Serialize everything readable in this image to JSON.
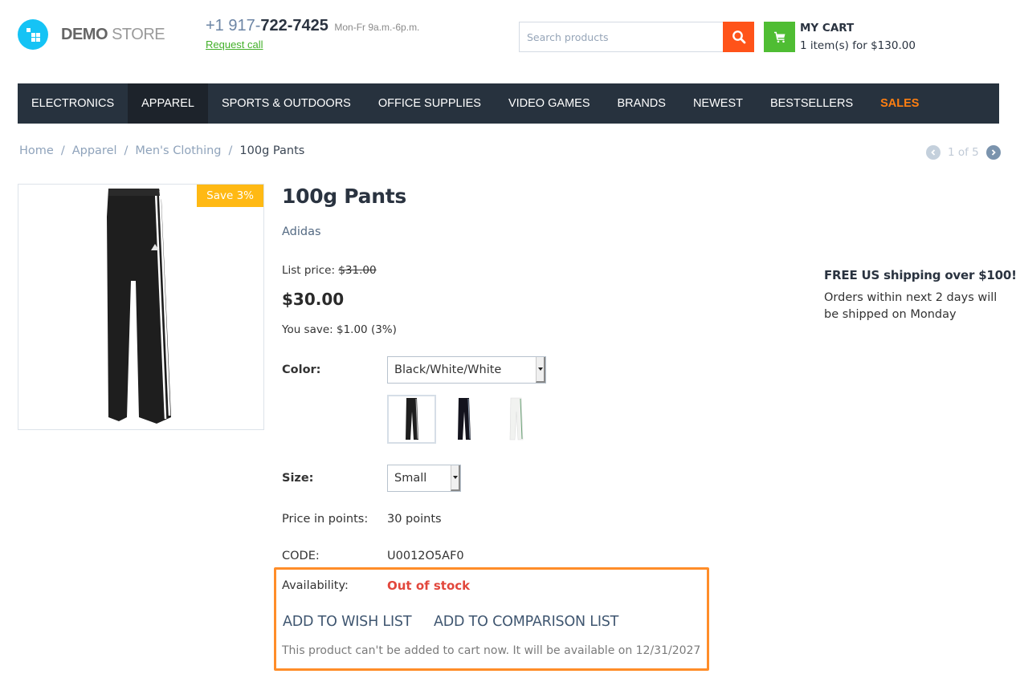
{
  "header": {
    "logo": {
      "bold": "DEMO",
      "light": "STORE"
    },
    "phone": {
      "prefix": "+1 917-",
      "number": "722-7425",
      "hours": "Mon-Fr 9a.m.-6p.m.",
      "request_call": "Request call"
    },
    "search": {
      "placeholder": "Search products",
      "value": ""
    },
    "cart": {
      "title": "MY CART",
      "summary": "1 item(s) for $130.00"
    }
  },
  "nav": {
    "items": [
      {
        "label": "ELECTRONICS"
      },
      {
        "label": "APPAREL",
        "active": true
      },
      {
        "label": "SPORTS & OUTDOORS"
      },
      {
        "label": "OFFICE SUPPLIES"
      },
      {
        "label": "VIDEO GAMES"
      },
      {
        "label": "BRANDS"
      },
      {
        "label": "NEWEST"
      },
      {
        "label": "BESTSELLERS"
      },
      {
        "label": "SALES",
        "highlight": true
      }
    ]
  },
  "breadcrumb": {
    "items": [
      "Home",
      "Apparel",
      "Men's Clothing"
    ],
    "separator": "/",
    "current": "100g Pants"
  },
  "pager": {
    "text": "1 of 5"
  },
  "product": {
    "badge": "Save 3%",
    "title": "100g Pants",
    "brand": "Adidas",
    "list_price_label": "List price:",
    "list_price": "$31.00",
    "price": "$30.00",
    "you_save": "You save: $1.00 (3%)",
    "color_label": "Color:",
    "color_value": "Black/White/White",
    "color_swatches": [
      "Black/White/White",
      "Black/Navy",
      "White/Green"
    ],
    "size_label": "Size:",
    "size_value": "Small",
    "points_label": "Price in points:",
    "points_value": "30 points",
    "code_label": "CODE:",
    "code_value": "U0012O5AF0",
    "availability_label": "Availability:",
    "availability_value": "Out of stock",
    "wish_list": "ADD TO WISH LIST",
    "comparison_list": "ADD TO COMPARISON LIST",
    "availability_note": "This product can't be added to cart now. It will be available on 12/31/2027"
  },
  "shipping": {
    "title": "FREE US shipping over $100!",
    "text": "Orders within next 2 days will be shipped on Monday"
  },
  "colors": {
    "nav_bg": "#27323e",
    "accent_orange": "#ff5319",
    "cart_green": "#4fbd33",
    "sales": "#ff7f11",
    "badge": "#ffb914",
    "out_of_stock": "#e2473c",
    "highlight_border": "#ff8d29"
  }
}
